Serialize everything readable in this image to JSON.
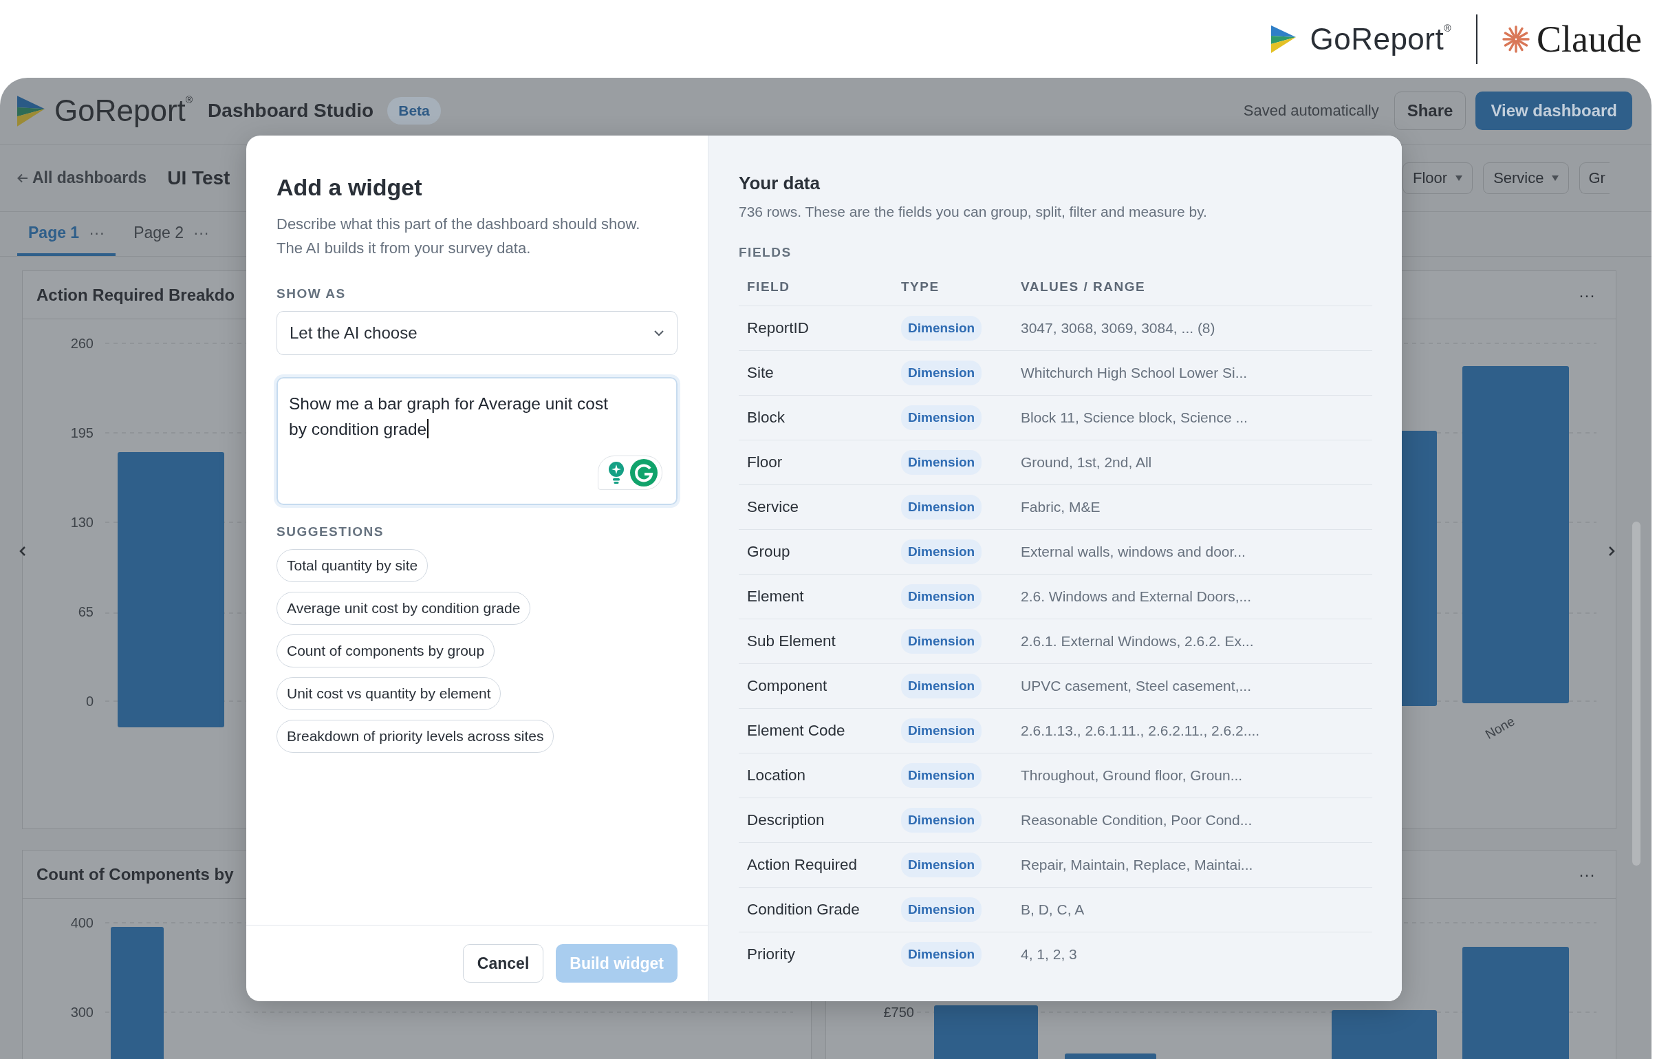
{
  "brand_bar": {
    "goreport": "GoReport$^{®}$",
    "claude": "Claude"
  },
  "app_header": {
    "brand": "GoReport$^{®}$",
    "title": "Dashboard Studio",
    "badge": "Beta",
    "save_status": "Saved automatically",
    "buttons": [
      {
        "label": "Share",
        "kind": "outline"
      },
      {
        "label": "View dashboard",
        "kind": "primary"
      }
    ]
  },
  "toolbar": {
    "back_link": "All dashboards",
    "dashboard_name": "UI Test",
    "filters": [
      {
        "label": "Floor",
        "dropdown": true
      },
      {
        "label": "Service",
        "dropdown": true
      },
      {
        "label": "Gr",
        "dropdown": false
      }
    ]
  },
  "page_tabs": [
    {
      "label": "Page 1",
      "selected": true,
      "menu": "···"
    },
    {
      "label": "Page 2",
      "selected": false,
      "menu": "···"
    }
  ],
  "widgets": [
    {
      "title": "Action Required Breakdo",
      "yticks": [
        "260",
        "195",
        "130",
        "65",
        "0"
      ]
    },
    {
      "menu": "···",
      "xlabels": [
        "None"
      ]
    },
    {
      "title": "Count of Components by",
      "yticks": [
        "400",
        "300"
      ]
    },
    {
      "menu": "···",
      "yticks": [
        "£750"
      ]
    }
  ],
  "modal": {
    "title": "Add a widget",
    "description": "Describe what this part of the dashboard should show. The AI builds it from your survey data.",
    "show_as": {
      "label": "SHOW AS",
      "value": "Let the AI choose"
    },
    "prompt": {
      "value": "Show me a bar graph for Average unit cost by condition grade",
      "focused": true
    },
    "suggestions": {
      "label": "SUGGESTIONS",
      "items": [
        "Total quantity by site",
        "Average unit cost by condition grade",
        "Count of components by group",
        "Unit cost vs quantity by element",
        "Breakdown of priority levels across sites"
      ]
    },
    "buttons": [
      {
        "label": "Cancel",
        "kind": "secondary",
        "disabled": false
      },
      {
        "label": "Build widget",
        "kind": "primary",
        "disabled": true
      }
    ],
    "data_panel": {
      "title": "Your data",
      "description": "736 rows. These are the fields you can group, split, filter and measure by.",
      "section_label": "FIELDS",
      "columns": [
        "FIELD",
        "TYPE",
        "VALUES / RANGE"
      ],
      "rows": [
        {
          "field": "ReportID",
          "type": "Dimension",
          "values": "3047, 3068, 3069, 3084, ... (8)"
        },
        {
          "field": "Site",
          "type": "Dimension",
          "values": "Whitchurch High School Lower Si..."
        },
        {
          "field": "Block",
          "type": "Dimension",
          "values": "Block 11, Science block, Science ..."
        },
        {
          "field": "Floor",
          "type": "Dimension",
          "values": "Ground, 1st, 2nd, All"
        },
        {
          "field": "Service",
          "type": "Dimension",
          "values": "Fabric, M&E"
        },
        {
          "field": "Group",
          "type": "Dimension",
          "values": "External walls, windows and door..."
        },
        {
          "field": "Element",
          "type": "Dimension",
          "values": "2.6. Windows and External Doors,..."
        },
        {
          "field": "Sub Element",
          "type": "Dimension",
          "values": "2.6.1. External Windows, 2.6.2. Ex..."
        },
        {
          "field": "Component",
          "type": "Dimension",
          "values": "UPVC casement, Steel casement,..."
        },
        {
          "field": "Element Code",
          "type": "Dimension",
          "values": "2.6.1.13., 2.6.1.11., 2.6.2.11., 2.6.2...."
        },
        {
          "field": "Location",
          "type": "Dimension",
          "values": "Throughout, Ground floor, Groun..."
        },
        {
          "field": "Description",
          "type": "Dimension",
          "values": "Reasonable Condition, Poor Cond..."
        },
        {
          "field": "Action Required",
          "type": "Dimension",
          "values": "Repair, Maintain, Replace, Maintai..."
        },
        {
          "field": "Condition Grade",
          "type": "Dimension",
          "values": "B, D, C, A"
        },
        {
          "field": "Priority",
          "type": "Dimension",
          "values": "4, 1, 2, 3"
        }
      ]
    }
  }
}
